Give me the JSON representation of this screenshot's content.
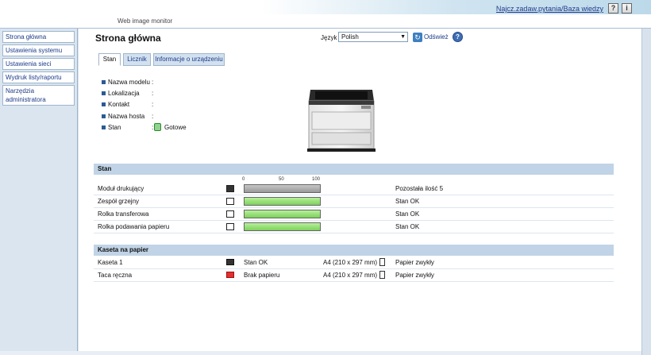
{
  "header": {
    "subtitle": "Web image monitor",
    "faq_link": "Najcz.zadaw.pytania/Baza wiedzy",
    "help_button": "?",
    "info_button": "i"
  },
  "sidebar": {
    "items": [
      {
        "label": "Strona główna"
      },
      {
        "label": "Ustawienia systemu"
      },
      {
        "label": "Ustawienia sieci"
      },
      {
        "label": "Wydruk listy/raportu"
      },
      {
        "label": "Narzędzia administratora"
      }
    ]
  },
  "main": {
    "title": "Strona główna",
    "language_label": "Język",
    "language_value": "Polish",
    "refresh_label": "Odśwież",
    "tabs": [
      {
        "label": "Stan",
        "active": true
      },
      {
        "label": "Licznik",
        "active": false
      },
      {
        "label": "Informacje o urządzeniu",
        "active": false
      }
    ],
    "device_info": [
      {
        "label": "Nazwa modelu",
        "value": ""
      },
      {
        "label": "Lokalizacja",
        "value": ""
      },
      {
        "label": "Kontakt",
        "value": ""
      },
      {
        "label": "Nazwa hosta",
        "value": ""
      },
      {
        "label": "Stan",
        "value": "Gotowe"
      }
    ],
    "status_section": {
      "title": "Stan",
      "scale": [
        "0",
        "50",
        "100"
      ],
      "rows": [
        {
          "name": "Moduł drukujący",
          "level": 100,
          "bar_color": "gray",
          "status": "Pozostała ilość 5"
        },
        {
          "name": "Zespół grzejny",
          "level": 100,
          "bar_color": "green",
          "status": "Stan OK"
        },
        {
          "name": "Rolka transferowa",
          "level": 100,
          "bar_color": "green",
          "status": "Stan OK"
        },
        {
          "name": "Rolka podawania papieru",
          "level": 100,
          "bar_color": "green",
          "status": "Stan OK"
        }
      ]
    },
    "paper_section": {
      "title": "Kaseta na papier",
      "rows": [
        {
          "name": "Kaseta 1",
          "status": "Stan OK",
          "empty": false,
          "size": "A4 (210 x 297 mm)",
          "type": "Papier zwykły"
        },
        {
          "name": "Taca ręczna",
          "status": "Brak papieru",
          "empty": true,
          "size": "A4 (210 x 297 mm)",
          "type": "Papier zwykły"
        }
      ]
    }
  },
  "colors": {
    "link": "#1b3b8a",
    "section_header": "#c1d3e6",
    "ok_green": "#7dd15a",
    "error_red": "#e03030"
  }
}
